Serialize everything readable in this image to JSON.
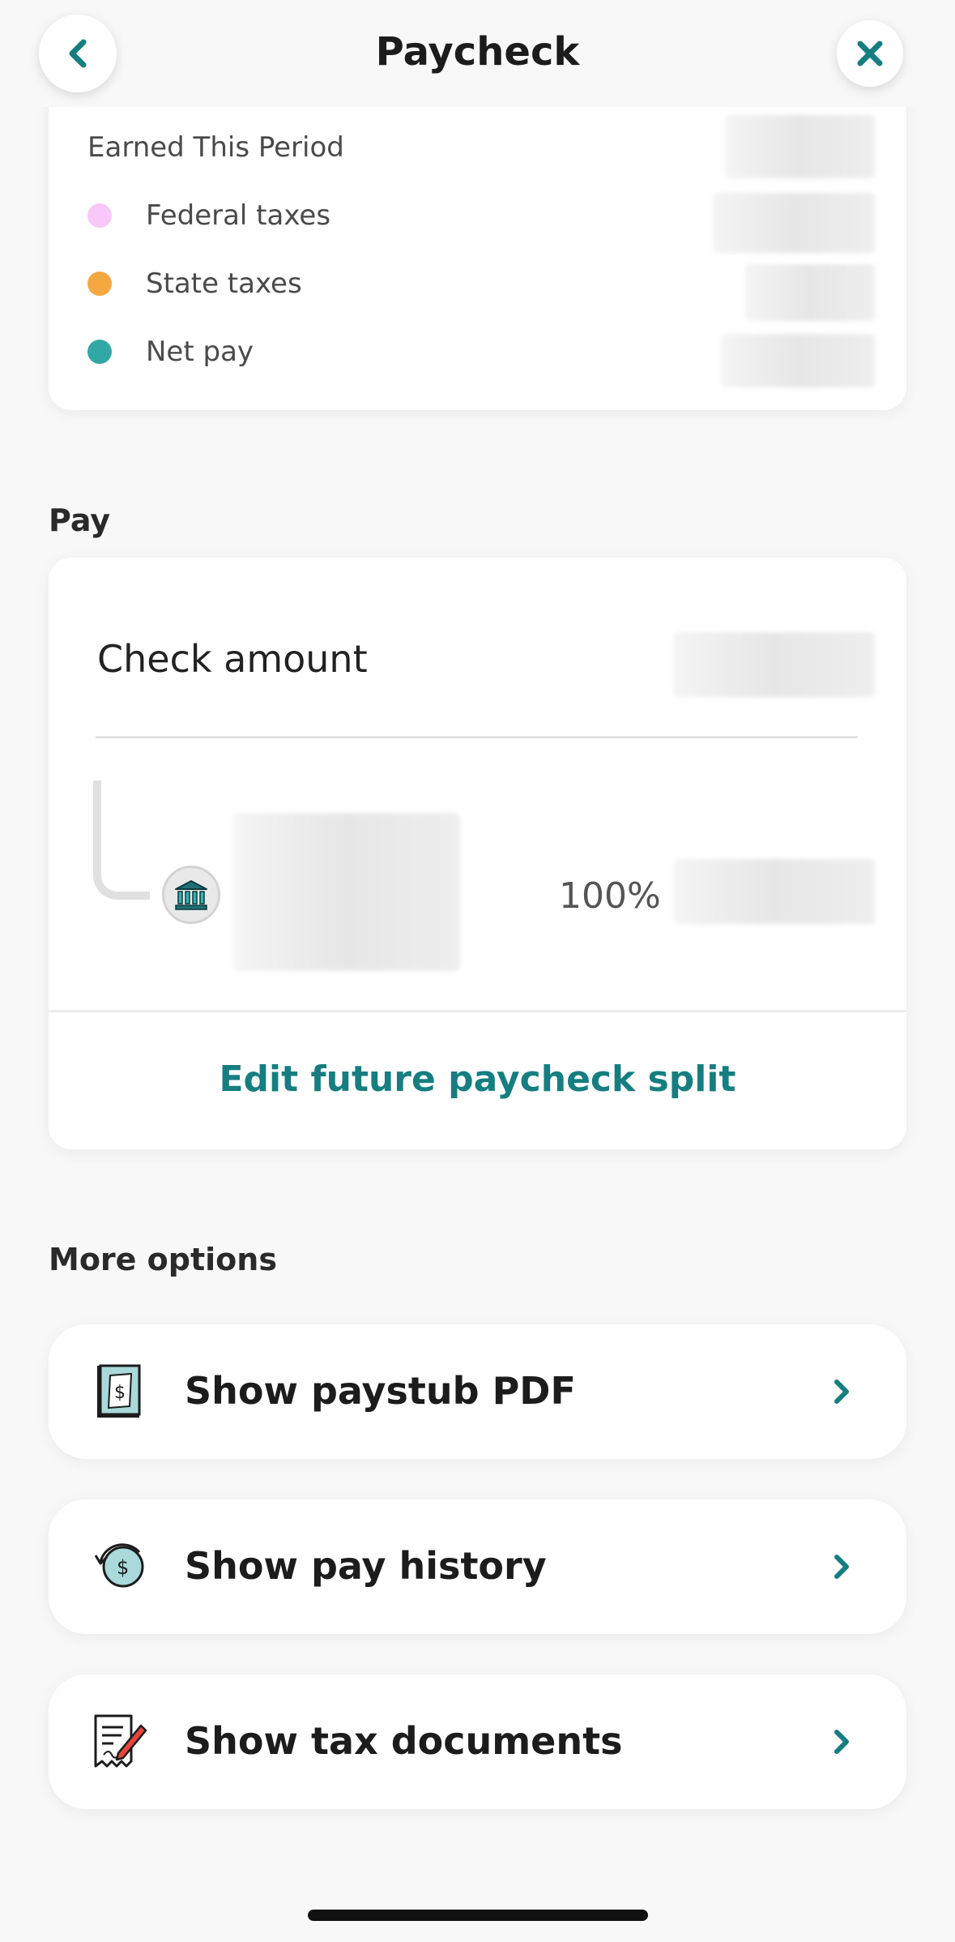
{
  "header": {
    "title": "Paycheck"
  },
  "earnings": {
    "title": "Earned This Period",
    "items": [
      {
        "label": "Federal taxes",
        "color": "#f8c8f8"
      },
      {
        "label": "State taxes",
        "color": "#f5a742"
      },
      {
        "label": "Net pay",
        "color": "#32a8a6"
      }
    ]
  },
  "pay": {
    "section_title": "Pay",
    "check_label": "Check amount",
    "split_percent": "100%",
    "edit_label": "Edit future paycheck split"
  },
  "more_options": {
    "section_title": "More options",
    "items": [
      {
        "label": "Show paystub PDF",
        "icon": "paystub-icon"
      },
      {
        "label": "Show pay history",
        "icon": "pay-history-icon"
      },
      {
        "label": "Show tax documents",
        "icon": "tax-documents-icon"
      }
    ]
  },
  "colors": {
    "accent": "#167e80",
    "background": "#f8f8f8"
  }
}
